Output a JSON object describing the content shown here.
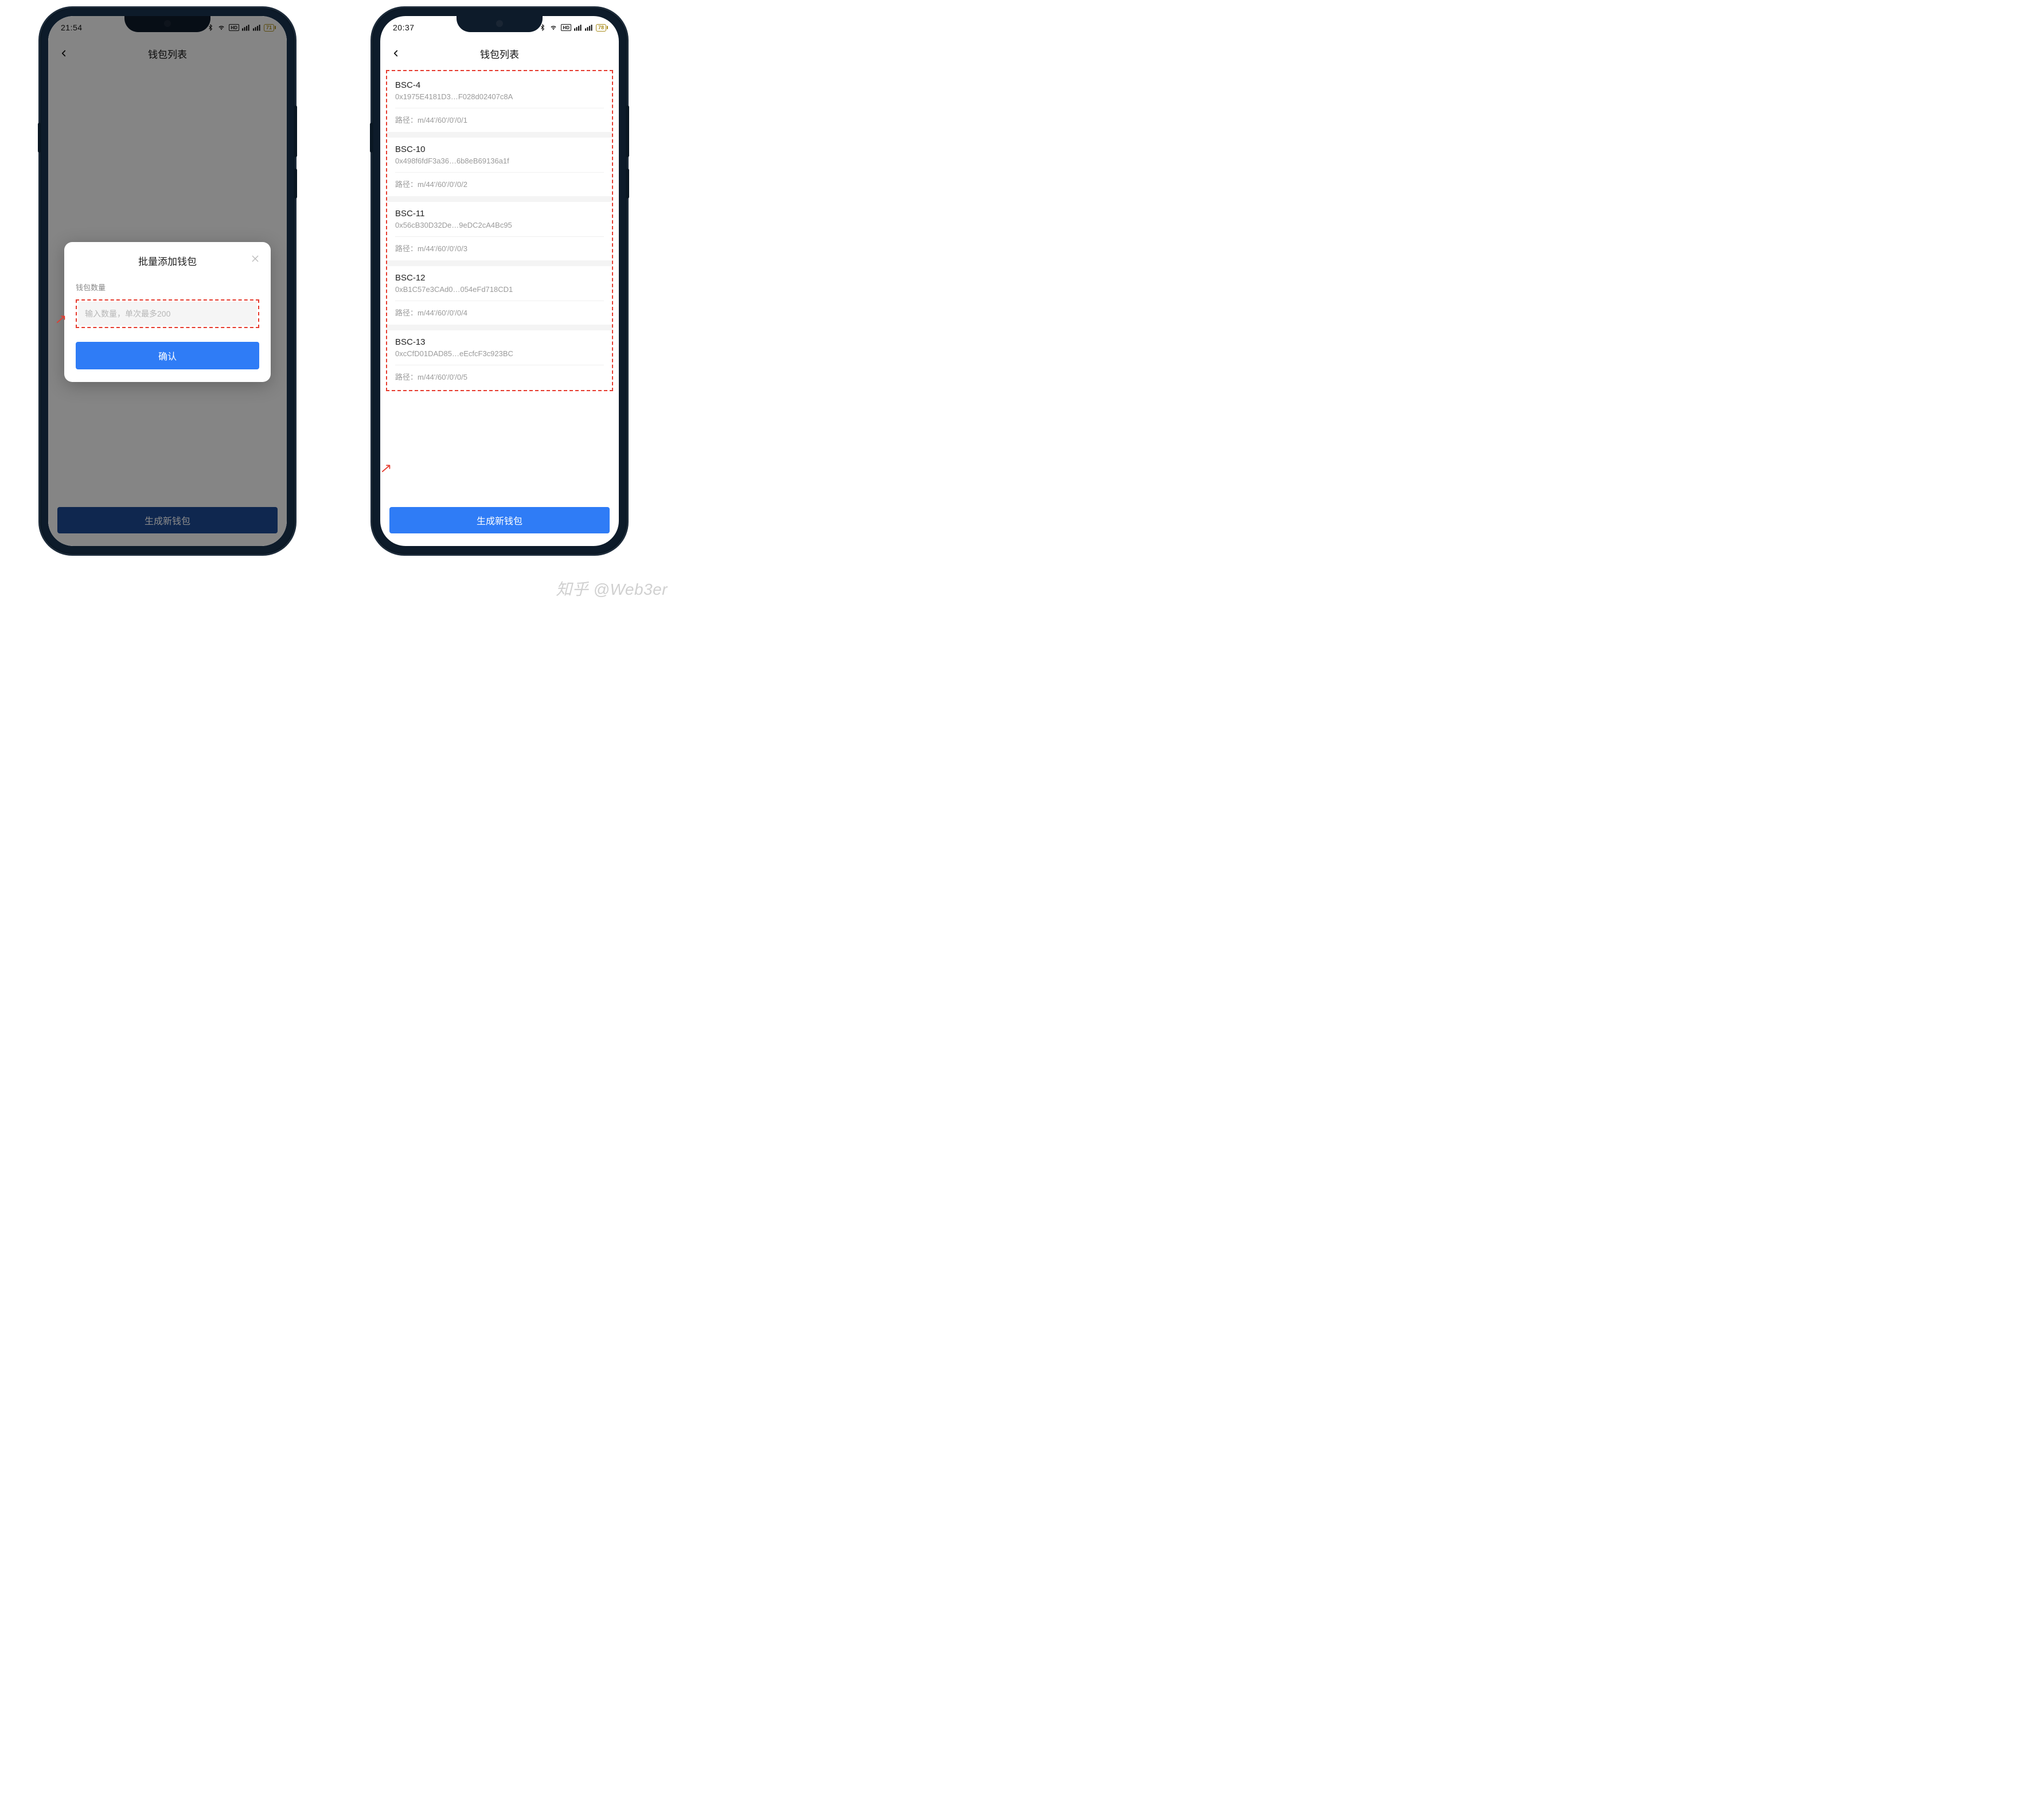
{
  "watermark": "知乎 @Web3er",
  "left": {
    "status": {
      "time": "21:54",
      "battery": "71"
    },
    "nav_title": "钱包列表",
    "footer_button": "生成新钱包",
    "modal": {
      "title": "批量添加钱包",
      "label": "钱包数量",
      "placeholder": "输入数量，单次最多200",
      "confirm": "确认"
    }
  },
  "right": {
    "status": {
      "time": "20:37",
      "battery": "78"
    },
    "nav_title": "钱包列表",
    "footer_button": "生成新钱包",
    "path_label": "路径：",
    "wallets": [
      {
        "name": "BSC-4",
        "addr": "0x1975E4181D3…F028d02407c8A",
        "path": "m/44'/60'/0'/0/1"
      },
      {
        "name": "BSC-10",
        "addr": "0x498f6fdF3a36…6b8eB69136a1f",
        "path": "m/44'/60'/0'/0/2"
      },
      {
        "name": "BSC-11",
        "addr": "0x56cB30D32De…9eDC2cA4Bc95",
        "path": "m/44'/60'/0'/0/3"
      },
      {
        "name": "BSC-12",
        "addr": "0xB1C57e3CAd0…054eFd718CD1",
        "path": "m/44'/60'/0'/0/4"
      },
      {
        "name": "BSC-13",
        "addr": "0xcCfD01DAD85…eEcfcF3c923BC",
        "path": "m/44'/60'/0'/0/5"
      }
    ]
  }
}
